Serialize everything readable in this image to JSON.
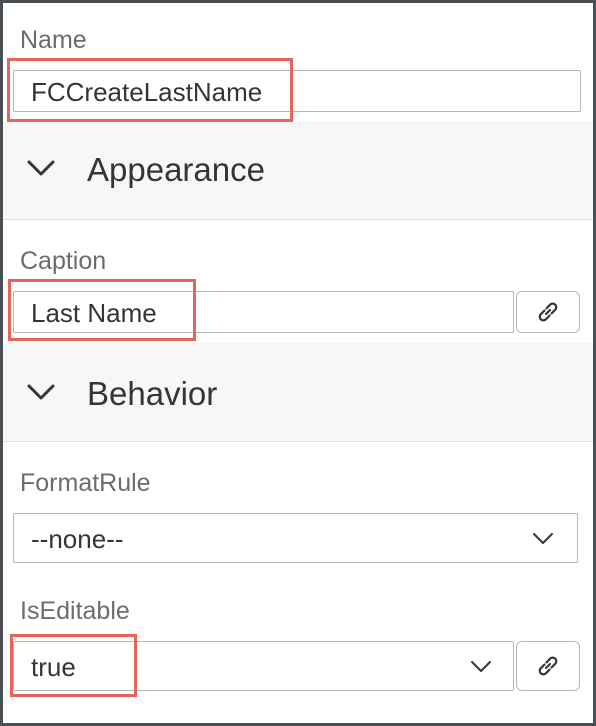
{
  "name": {
    "label": "Name",
    "value": "FCCreateLastName"
  },
  "appearance": {
    "title": "Appearance",
    "caption_label": "Caption",
    "caption_value": "Last Name"
  },
  "behavior": {
    "title": "Behavior",
    "formatrule_label": "FormatRule",
    "formatrule_value": "--none--",
    "iseditable_label": "IsEditable",
    "iseditable_value": "true"
  },
  "icons": {
    "section_toggle": "chevron-down-icon",
    "bind": "link-icon",
    "dropdown": "chevron-down-icon"
  },
  "colors": {
    "highlight": "#e2675a",
    "section_bg": "#f7f7f7",
    "frame_border": "#4a4f55"
  }
}
